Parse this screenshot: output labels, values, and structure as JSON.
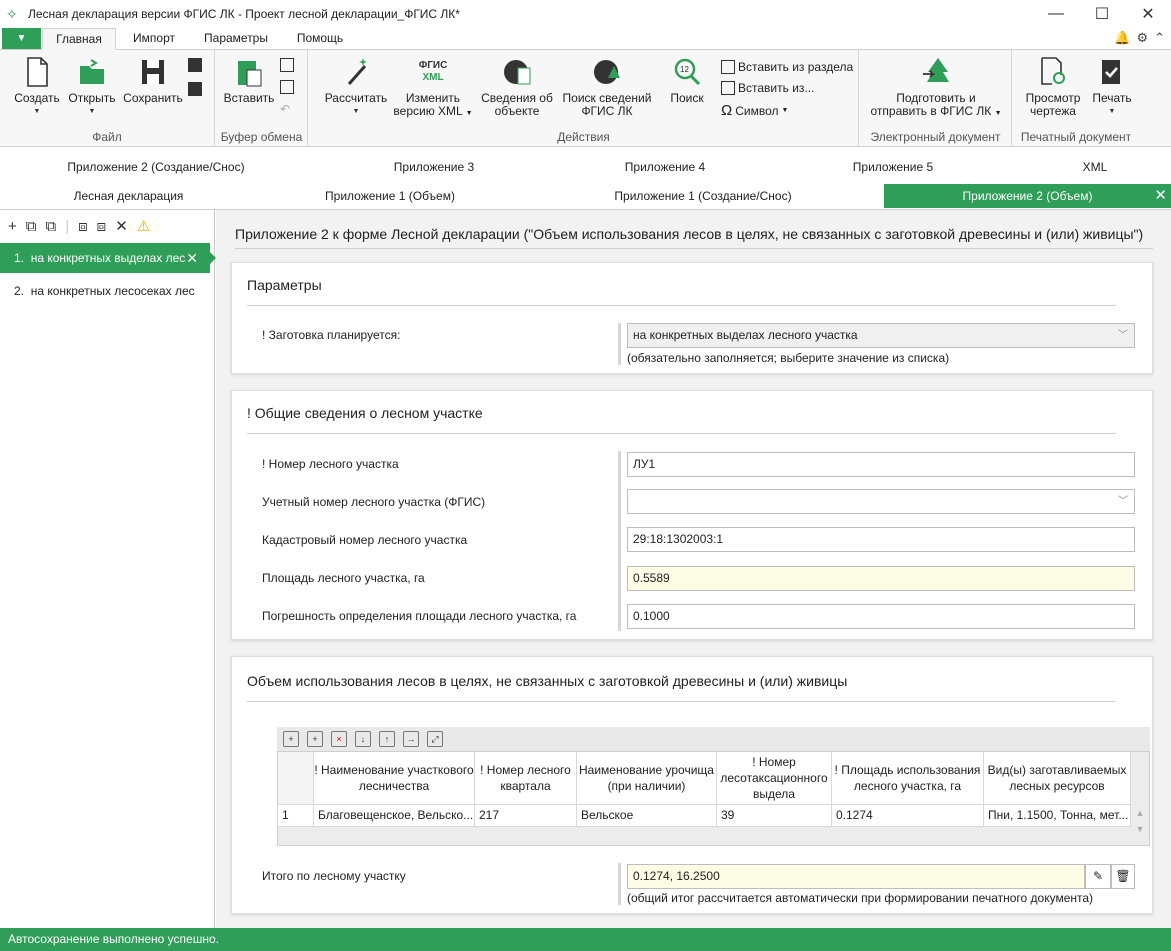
{
  "window": {
    "title": "Лесная декларация версии ФГИС ЛК - Проект лесной декларации_ФГИС ЛК*"
  },
  "ribbon_tabs": [
    "Главная",
    "Импорт",
    "Параметры",
    "Помощь"
  ],
  "file_button": "▼",
  "ribbon": {
    "file_group": {
      "label": "Файл",
      "create": "Создать",
      "open": "Открыть",
      "save": "Сохранить"
    },
    "clipboard_group": {
      "label": "Буфер обмена",
      "paste": "Вставить"
    },
    "actions_group": {
      "label": "Действия",
      "calculate": "Рассчитать",
      "change_xml_1": "Изменить",
      "change_xml_2": "версию XML",
      "fgis_xml_1": "ФГИС",
      "fgis_xml_2": "XML",
      "object_info_1": "Сведения об",
      "object_info_2": "объекте",
      "search_info_1": "Поиск сведений",
      "search_info_2": "ФГИС ЛК",
      "search": "Поиск",
      "search_num": "12",
      "insert_section": "Вставить из раздела",
      "insert_from": "Вставить из...",
      "symbol": "Символ"
    },
    "edoc_group": {
      "label": "Электронный документ",
      "prepare_1": "Подготовить и",
      "prepare_2": "отправить в ФГИС ЛК"
    },
    "print_group": {
      "label": "Печатный документ",
      "preview_1": "Просмотр",
      "preview_2": "чертежа",
      "print": "Печать"
    }
  },
  "doc_tabs_row1": [
    "Приложение 2 (Создание/Снос)",
    "Приложение 3",
    "Приложение 4",
    "Приложение 5",
    "XML"
  ],
  "doc_tabs_row2": [
    "Лесная декларация",
    "Приложение 1 (Объем)",
    "Приложение 1 (Создание/Снос)",
    "Приложение 2 (Объем)"
  ],
  "left_items": [
    {
      "num": "1.",
      "label": "на конкретных выделах лес"
    },
    {
      "num": "2.",
      "label": "на конкретных лесосеках лес"
    }
  ],
  "main_title": "Приложение 2 к форме Лесной декларации (\"Объем использования лесов в целях, не связанных с заготовкой древесины и (или) живицы\")",
  "params": {
    "title": "Параметры",
    "label": "! Заготовка планируется:",
    "value": "на конкретных выделах лесного участка",
    "hint": "(обязательно заполняется; выберите значение из списка)"
  },
  "general": {
    "title": "! Общие сведения о лесном участке",
    "fields": [
      {
        "label": "! Номер лесного участка",
        "value": "ЛУ1"
      },
      {
        "label": "Учетный номер лесного участка (ФГИС)",
        "value": ""
      },
      {
        "label": "Кадастровый номер лесного участка",
        "value": "29:18:1302003:1"
      },
      {
        "label": "Площадь лесного участка, га",
        "value": "0.5589"
      },
      {
        "label": "Погрешность определения площади лесного участка, га",
        "value": "0.1000"
      }
    ]
  },
  "volume": {
    "title": "Объем использования лесов в целях, не связанных с заготовкой древесины и (или) живицы",
    "headers": [
      "! Наименование участкового лесничества",
      "! Номер лесного квартала",
      "Наименование урочища (при наличии)",
      "! Номер лесотаксационного выдела",
      "! Площадь использования лесного участка, га",
      "Вид(ы) заготавливаемых лесных ресурсов"
    ],
    "rows": [
      {
        "n": "1",
        "cells": [
          "Благовещенское, Вельско...",
          "217",
          "Вельское",
          "39",
          "0.1274",
          "Пни, 1.1500, Тонна, мет..."
        ]
      }
    ],
    "total_label": "Итого по лесному участку",
    "total_value": "0.1274, 16.2500",
    "total_hint": "(общий итог рассчитается автоматически при формировании печатного документа)"
  },
  "status": "Автосохранение выполнено успешно."
}
